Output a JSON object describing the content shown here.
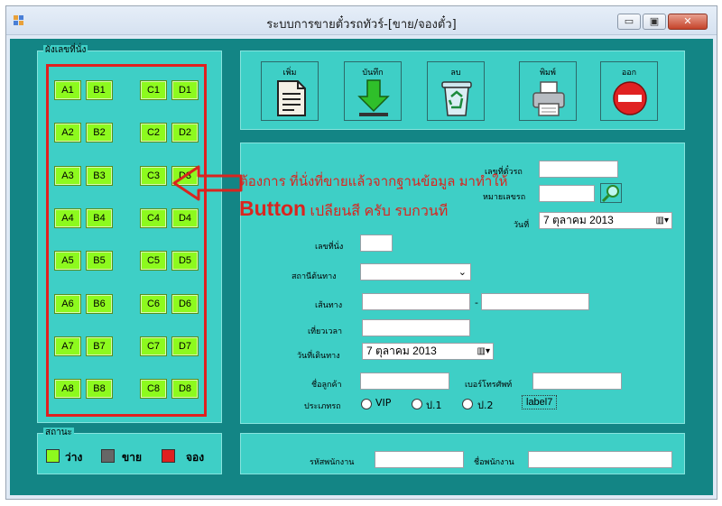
{
  "window": {
    "title": "ระบบการขายตั๋วรถทัวร์-[ขาย/จองตั๋ว]",
    "min_glyph": "▭",
    "max_glyph": "▣",
    "close_glyph": "✕"
  },
  "seat_panel": {
    "title": "ผังเลขที่นั่ง",
    "seats": [
      "A1",
      "B1",
      "C1",
      "D1",
      "A2",
      "B2",
      "C2",
      "D2",
      "A3",
      "B3",
      "C3",
      "D3",
      "A4",
      "B4",
      "C4",
      "D4",
      "A5",
      "B5",
      "C5",
      "D5",
      "A6",
      "B6",
      "C6",
      "D6",
      "A7",
      "B7",
      "C7",
      "D7",
      "A8",
      "B8",
      "C8",
      "D8"
    ]
  },
  "status_panel": {
    "title": "สถานะ",
    "items": [
      {
        "label": "ว่าง",
        "color": "#8dfa1e"
      },
      {
        "label": "ขาย",
        "color": "#666666"
      },
      {
        "label": "จอง",
        "color": "#e0201f"
      }
    ]
  },
  "toolbar": {
    "add": "เพิ่ม",
    "save": "บันทึก",
    "delete": "ลบ",
    "print": "พิมพ์",
    "exit": "ออก"
  },
  "form": {
    "ticket_no_label": "เลขที่ตั๋วรถ",
    "bus_no_label": "หมายเลขรถ",
    "date_label": "วันที่",
    "date_value": "7   ตุลาคม   2013",
    "seat_no_label": "เลขที่นั่ง",
    "origin_label": "สถานีต้นทาง",
    "route_label": "เส้นทาง",
    "route_sep": "-",
    "trip_time_label": "เที่ยวเวลา",
    "depart_date_label": "วันที่เดินทาง",
    "depart_date_value": "7   ตุลาคม   2013",
    "customer_name_label": "ชื่อลูกค้า",
    "phone_label": "เบอร์โทรศัพท์",
    "bus_type_label": "ประเภทรถ",
    "bus_types": [
      "VIP",
      "ป.1",
      "ป.2"
    ],
    "label7": "label7"
  },
  "employee": {
    "code_label": "รหัสพนักงาน",
    "name_label": "ชื่อพนักงาน"
  },
  "annotation": {
    "line1": "ต้องการ ที่นั่งที่ขายแล้วจากฐานข้อมูล มาทำให้",
    "line2_bold": "Button",
    "line2_rest": " เปลียนสี ครับ รบกวนที",
    "color": "#d9251f"
  }
}
